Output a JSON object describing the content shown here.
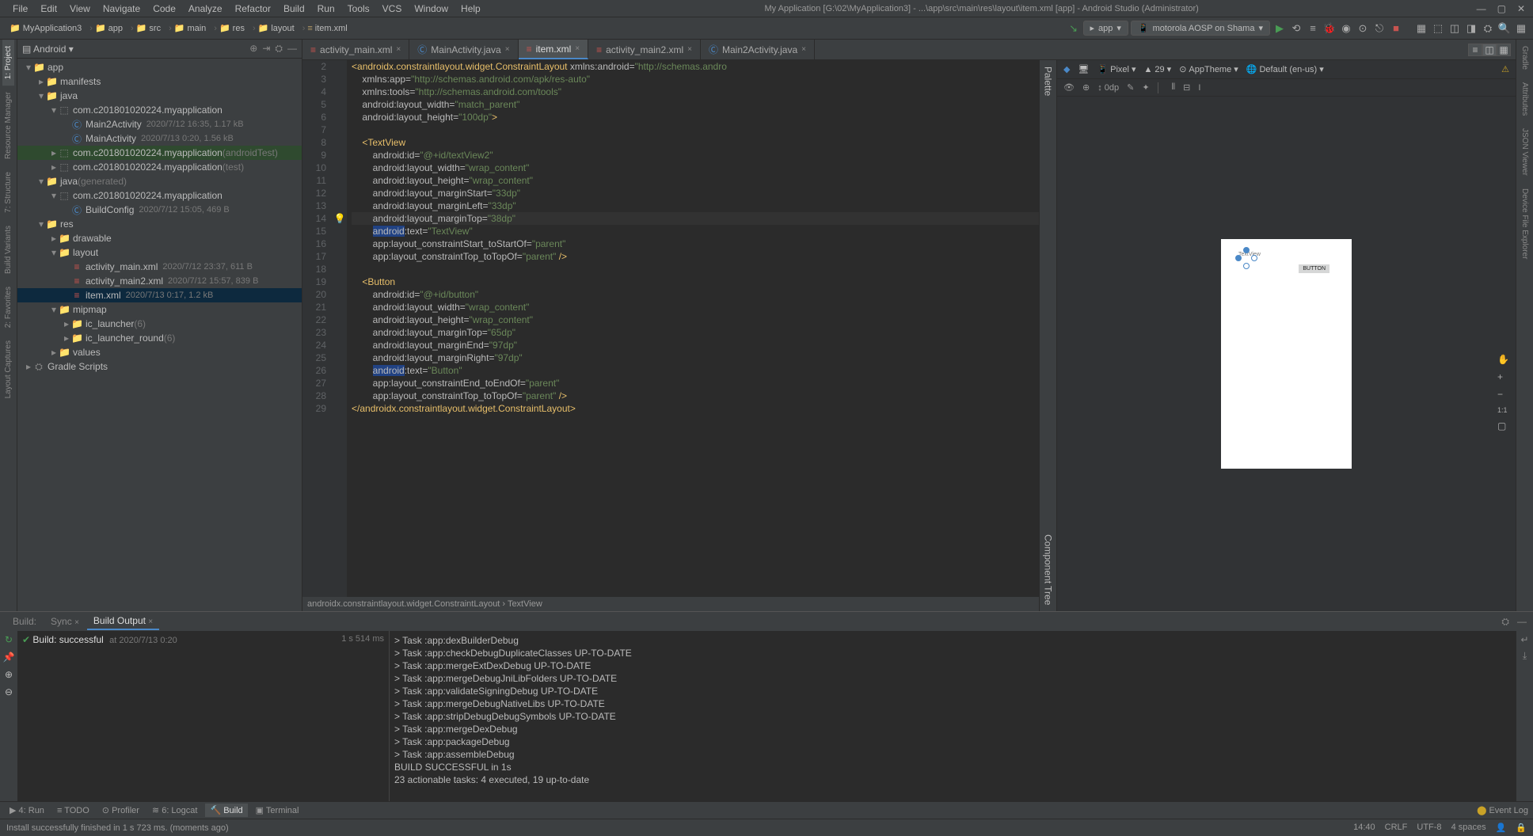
{
  "titlebar": {
    "text": "My Application [G:\\02\\MyApplication3] - ...\\app\\src\\main\\res\\layout\\item.xml [app] - Android Studio (Administrator)"
  },
  "menu": [
    "File",
    "Edit",
    "View",
    "Navigate",
    "Code",
    "Analyze",
    "Refactor",
    "Build",
    "Run",
    "Tools",
    "VCS",
    "Window",
    "Help"
  ],
  "breadcrumbs": [
    "MyApplication3",
    "app",
    "src",
    "main",
    "res",
    "layout",
    "item.xml"
  ],
  "run_config": "app",
  "device": "motorola AOSP on Shama",
  "project_header": "Android",
  "tree": [
    {
      "depth": 0,
      "arrow": "▾",
      "icon": "📁",
      "label": "app",
      "sel": false,
      "cls": "icon-folder"
    },
    {
      "depth": 1,
      "arrow": "▸",
      "icon": "📁",
      "label": "manifests",
      "sel": false,
      "cls": "icon-folder"
    },
    {
      "depth": 1,
      "arrow": "▾",
      "icon": "📁",
      "label": "java",
      "sel": false,
      "cls": "icon-folder"
    },
    {
      "depth": 2,
      "arrow": "▾",
      "icon": "⬚",
      "label": "com.c201801020224.myapplication",
      "sel": false,
      "cls": "icon-pkg"
    },
    {
      "depth": 3,
      "arrow": "",
      "icon": "Ⓒ",
      "label": "Main2Activity",
      "meta": "2020/7/12 16:35, 1.17 kB",
      "sel": false,
      "cls": "icon-class"
    },
    {
      "depth": 3,
      "arrow": "",
      "icon": "Ⓒ",
      "label": "MainActivity",
      "meta": "2020/7/13 0:20, 1.56 kB",
      "sel": false,
      "cls": "icon-class"
    },
    {
      "depth": 2,
      "arrow": "▸",
      "icon": "⬚",
      "label": "com.c201801020224.myapplication",
      "suffix": "(androidTest)",
      "sel": false,
      "hl": true,
      "cls": "icon-pkg"
    },
    {
      "depth": 2,
      "arrow": "▸",
      "icon": "⬚",
      "label": "com.c201801020224.myapplication",
      "suffix": "(test)",
      "sel": false,
      "cls": "icon-pkg"
    },
    {
      "depth": 1,
      "arrow": "▾",
      "icon": "📁",
      "label": "java",
      "suffix": "(generated)",
      "sel": false,
      "cls": "icon-folder"
    },
    {
      "depth": 2,
      "arrow": "▾",
      "icon": "⬚",
      "label": "com.c201801020224.myapplication",
      "sel": false,
      "cls": "icon-pkg"
    },
    {
      "depth": 3,
      "arrow": "",
      "icon": "Ⓒ",
      "label": "BuildConfig",
      "meta": "2020/7/12 15:05, 469 B",
      "sel": false,
      "cls": "icon-class"
    },
    {
      "depth": 1,
      "arrow": "▾",
      "icon": "📁",
      "label": "res",
      "sel": false,
      "cls": "icon-folder"
    },
    {
      "depth": 2,
      "arrow": "▸",
      "icon": "📁",
      "label": "drawable",
      "sel": false,
      "cls": "icon-folder"
    },
    {
      "depth": 2,
      "arrow": "▾",
      "icon": "📁",
      "label": "layout",
      "sel": false,
      "cls": "icon-folder"
    },
    {
      "depth": 3,
      "arrow": "",
      "icon": "≡",
      "label": "activity_main.xml",
      "meta": "2020/7/12 23:37, 611 B",
      "sel": false,
      "cls": "icon-xml"
    },
    {
      "depth": 3,
      "arrow": "",
      "icon": "≡",
      "label": "activity_main2.xml",
      "meta": "2020/7/12 15:57, 839 B",
      "sel": false,
      "cls": "icon-xml"
    },
    {
      "depth": 3,
      "arrow": "",
      "icon": "≡",
      "label": "item.xml",
      "meta": "2020/7/13 0:17, 1.2 kB",
      "sel": true,
      "cls": "icon-xml"
    },
    {
      "depth": 2,
      "arrow": "▾",
      "icon": "📁",
      "label": "mipmap",
      "sel": false,
      "cls": "icon-folder"
    },
    {
      "depth": 3,
      "arrow": "▸",
      "icon": "📁",
      "label": "ic_launcher",
      "suffix": "(6)",
      "sel": false,
      "cls": "icon-folder"
    },
    {
      "depth": 3,
      "arrow": "▸",
      "icon": "📁",
      "label": "ic_launcher_round",
      "suffix": "(6)",
      "sel": false,
      "cls": "icon-folder"
    },
    {
      "depth": 2,
      "arrow": "▸",
      "icon": "📁",
      "label": "values",
      "sel": false,
      "cls": "icon-folder"
    },
    {
      "depth": 0,
      "arrow": "▸",
      "icon": "⛭",
      "label": "Gradle Scripts",
      "sel": false,
      "cls": "icon-pkg"
    }
  ],
  "editor_tabs": [
    {
      "label": "activity_main.xml",
      "icon": "≡",
      "active": false
    },
    {
      "label": "MainActivity.java",
      "icon": "Ⓒ",
      "active": false
    },
    {
      "label": "item.xml",
      "icon": "≡",
      "active": true
    },
    {
      "label": "activity_main2.xml",
      "icon": "≡",
      "active": false
    },
    {
      "label": "Main2Activity.java",
      "icon": "Ⓒ",
      "active": false
    }
  ],
  "code": [
    {
      "n": 2,
      "tokens": [
        {
          "t": "<",
          "c": "t-tag"
        },
        {
          "t": "androidx.constraintlayout.widget.ConstraintLayout",
          "c": "t-tag"
        },
        {
          "t": " xmlns:",
          "c": "t-ns"
        },
        {
          "t": "android",
          "c": "t-attr"
        },
        {
          "t": "=",
          "c": "t-eq"
        },
        {
          "t": "\"http://schemas.andro",
          "c": "t-val"
        }
      ]
    },
    {
      "n": 3,
      "tokens": [
        {
          "t": "    xmlns:",
          "c": "t-ns"
        },
        {
          "t": "app",
          "c": "t-attr"
        },
        {
          "t": "=",
          "c": "t-eq"
        },
        {
          "t": "\"http://schemas.android.com/apk/res-auto\"",
          "c": "t-val"
        }
      ]
    },
    {
      "n": 4,
      "tokens": [
        {
          "t": "    xmlns:",
          "c": "t-ns"
        },
        {
          "t": "tools",
          "c": "t-attr"
        },
        {
          "t": "=",
          "c": "t-eq"
        },
        {
          "t": "\"http://schemas.android.com/tools\"",
          "c": "t-val"
        }
      ]
    },
    {
      "n": 5,
      "tokens": [
        {
          "t": "    android:",
          "c": "t-ns"
        },
        {
          "t": "layout_width",
          "c": "t-attr"
        },
        {
          "t": "=",
          "c": "t-eq"
        },
        {
          "t": "\"match_parent\"",
          "c": "t-val"
        }
      ]
    },
    {
      "n": 6,
      "tokens": [
        {
          "t": "    android:",
          "c": "t-ns"
        },
        {
          "t": "layout_height",
          "c": "t-attr"
        },
        {
          "t": "=",
          "c": "t-eq"
        },
        {
          "t": "\"100dp\"",
          "c": "t-val"
        },
        {
          "t": ">",
          "c": "t-tag"
        }
      ]
    },
    {
      "n": 7,
      "tokens": []
    },
    {
      "n": 8,
      "tokens": [
        {
          "t": "    <",
          "c": "t-tag"
        },
        {
          "t": "TextView",
          "c": "t-tag"
        }
      ]
    },
    {
      "n": 9,
      "tokens": [
        {
          "t": "        android:",
          "c": "t-ns"
        },
        {
          "t": "id",
          "c": "t-attr"
        },
        {
          "t": "=",
          "c": "t-eq"
        },
        {
          "t": "\"@+id/textView2\"",
          "c": "t-val"
        }
      ]
    },
    {
      "n": 10,
      "tokens": [
        {
          "t": "        android:",
          "c": "t-ns"
        },
        {
          "t": "layout_width",
          "c": "t-attr"
        },
        {
          "t": "=",
          "c": "t-eq"
        },
        {
          "t": "\"wrap_content\"",
          "c": "t-val"
        }
      ]
    },
    {
      "n": 11,
      "tokens": [
        {
          "t": "        android:",
          "c": "t-ns"
        },
        {
          "t": "layout_height",
          "c": "t-attr"
        },
        {
          "t": "=",
          "c": "t-eq"
        },
        {
          "t": "\"wrap_content\"",
          "c": "t-val"
        }
      ]
    },
    {
      "n": 12,
      "tokens": [
        {
          "t": "        android:",
          "c": "t-ns"
        },
        {
          "t": "layout_marginStart",
          "c": "t-attr"
        },
        {
          "t": "=",
          "c": "t-eq"
        },
        {
          "t": "\"33dp\"",
          "c": "t-val"
        }
      ]
    },
    {
      "n": 13,
      "tokens": [
        {
          "t": "        android:",
          "c": "t-ns"
        },
        {
          "t": "layout_marginLeft",
          "c": "t-attr"
        },
        {
          "t": "=",
          "c": "t-eq"
        },
        {
          "t": "\"33dp\"",
          "c": "t-val"
        }
      ]
    },
    {
      "n": 14,
      "hl": true,
      "bulb": true,
      "tokens": [
        {
          "t": "        android:",
          "c": "t-ns"
        },
        {
          "t": "layout_marginTop",
          "c": "t-attr"
        },
        {
          "t": "=",
          "c": "t-eq"
        },
        {
          "t": "\"38dp\"",
          "c": "t-val"
        }
      ]
    },
    {
      "n": 15,
      "tokens": [
        {
          "t": "        ",
          "c": ""
        },
        {
          "t": "android",
          "c": "t-hl"
        },
        {
          "t": ":",
          "c": "t-ns"
        },
        {
          "t": "text",
          "c": "t-attr"
        },
        {
          "t": "=",
          "c": "t-eq"
        },
        {
          "t": "\"TextView\"",
          "c": "t-val"
        }
      ]
    },
    {
      "n": 16,
      "tokens": [
        {
          "t": "        app:",
          "c": "t-ns"
        },
        {
          "t": "layout_constraintStart_toStartOf",
          "c": "t-attr"
        },
        {
          "t": "=",
          "c": "t-eq"
        },
        {
          "t": "\"parent\"",
          "c": "t-val"
        }
      ]
    },
    {
      "n": 17,
      "tokens": [
        {
          "t": "        app:",
          "c": "t-ns"
        },
        {
          "t": "layout_constraintTop_toTopOf",
          "c": "t-attr"
        },
        {
          "t": "=",
          "c": "t-eq"
        },
        {
          "t": "\"parent\"",
          "c": "t-val"
        },
        {
          "t": " />",
          "c": "t-tag"
        }
      ]
    },
    {
      "n": 18,
      "tokens": []
    },
    {
      "n": 19,
      "tokens": [
        {
          "t": "    <",
          "c": "t-tag"
        },
        {
          "t": "Button",
          "c": "t-tag"
        }
      ]
    },
    {
      "n": 20,
      "tokens": [
        {
          "t": "        android:",
          "c": "t-ns"
        },
        {
          "t": "id",
          "c": "t-attr"
        },
        {
          "t": "=",
          "c": "t-eq"
        },
        {
          "t": "\"@+id/button\"",
          "c": "t-val"
        }
      ]
    },
    {
      "n": 21,
      "tokens": [
        {
          "t": "        android:",
          "c": "t-ns"
        },
        {
          "t": "layout_width",
          "c": "t-attr"
        },
        {
          "t": "=",
          "c": "t-eq"
        },
        {
          "t": "\"wrap_content\"",
          "c": "t-val"
        }
      ]
    },
    {
      "n": 22,
      "tokens": [
        {
          "t": "        android:",
          "c": "t-ns"
        },
        {
          "t": "layout_height",
          "c": "t-attr"
        },
        {
          "t": "=",
          "c": "t-eq"
        },
        {
          "t": "\"wrap_content\"",
          "c": "t-val"
        }
      ]
    },
    {
      "n": 23,
      "tokens": [
        {
          "t": "        android:",
          "c": "t-ns"
        },
        {
          "t": "layout_marginTop",
          "c": "t-attr"
        },
        {
          "t": "=",
          "c": "t-eq"
        },
        {
          "t": "\"65dp\"",
          "c": "t-val"
        }
      ]
    },
    {
      "n": 24,
      "tokens": [
        {
          "t": "        android:",
          "c": "t-ns"
        },
        {
          "t": "layout_marginEnd",
          "c": "t-attr"
        },
        {
          "t": "=",
          "c": "t-eq"
        },
        {
          "t": "\"97dp\"",
          "c": "t-val"
        }
      ]
    },
    {
      "n": 25,
      "tokens": [
        {
          "t": "        android:",
          "c": "t-ns"
        },
        {
          "t": "layout_marginRight",
          "c": "t-attr"
        },
        {
          "t": "=",
          "c": "t-eq"
        },
        {
          "t": "\"97dp\"",
          "c": "t-val"
        }
      ]
    },
    {
      "n": 26,
      "tokens": [
        {
          "t": "        ",
          "c": ""
        },
        {
          "t": "android",
          "c": "t-hl"
        },
        {
          "t": ":",
          "c": "t-ns"
        },
        {
          "t": "text",
          "c": "t-attr"
        },
        {
          "t": "=",
          "c": "t-eq"
        },
        {
          "t": "\"Button\"",
          "c": "t-val"
        }
      ]
    },
    {
      "n": 27,
      "tokens": [
        {
          "t": "        app:",
          "c": "t-ns"
        },
        {
          "t": "layout_constraintEnd_toEndOf",
          "c": "t-attr"
        },
        {
          "t": "=",
          "c": "t-eq"
        },
        {
          "t": "\"parent\"",
          "c": "t-val"
        }
      ]
    },
    {
      "n": 28,
      "tokens": [
        {
          "t": "        app:",
          "c": "t-ns"
        },
        {
          "t": "layout_constraintTop_toTopOf",
          "c": "t-attr"
        },
        {
          "t": "=",
          "c": "t-eq"
        },
        {
          "t": "\"parent\"",
          "c": "t-val"
        },
        {
          "t": " />",
          "c": "t-tag"
        }
      ]
    },
    {
      "n": 29,
      "tokens": [
        {
          "t": "</",
          "c": "t-tag"
        },
        {
          "t": "androidx.constraintlayout.widget.ConstraintLayout",
          "c": "t-tag"
        },
        {
          "t": ">",
          "c": "t-tag"
        }
      ]
    }
  ],
  "editor_breadcrumb": "androidx.constraintlayout.widget.ConstraintLayout  ›  TextView",
  "design": {
    "device": "Pixel",
    "api": "29",
    "theme": "AppTheme",
    "locale": "Default (en-us)",
    "margin": "0dp",
    "preview_button": "BUTTON",
    "preview_text": "TextView",
    "zoom": "1:1"
  },
  "build": {
    "tabs": [
      "Build:",
      "Sync",
      "Build Output"
    ],
    "status": "Build: successful",
    "status_time": "at 2020/7/13 0:20",
    "duration": "1 s 514 ms",
    "output": [
      "> Task :app:dexBuilderDebug",
      "> Task :app:checkDebugDuplicateClasses UP-TO-DATE",
      "> Task :app:mergeExtDexDebug UP-TO-DATE",
      "> Task :app:mergeDebugJniLibFolders UP-TO-DATE",
      "> Task :app:validateSigningDebug UP-TO-DATE",
      "> Task :app:mergeDebugNativeLibs UP-TO-DATE",
      "> Task :app:stripDebugDebugSymbols UP-TO-DATE",
      "> Task :app:mergeDexDebug",
      "> Task :app:packageDebug",
      "> Task :app:assembleDebug",
      "",
      "BUILD SUCCESSFUL in 1s",
      "23 actionable tasks: 4 executed, 19 up-to-date"
    ]
  },
  "bottom_tools": [
    {
      "label": "▶ 4: Run",
      "active": false
    },
    {
      "label": "≡ TODO",
      "active": false
    },
    {
      "label": "⊙ Profiler",
      "active": false
    },
    {
      "label": "≋ 6: Logcat",
      "active": false
    },
    {
      "label": "🔨 Build",
      "active": true
    },
    {
      "label": "▣ Terminal",
      "active": false
    }
  ],
  "event_log": "Event Log",
  "status": {
    "message": "Install successfully finished in 1 s 723 ms. (moments ago)",
    "pos": "14:40",
    "sep": "CRLF",
    "enc": "UTF-8",
    "indent": "4 spaces"
  },
  "left_tabs": [
    "1: Project",
    "Resource Manager",
    "7: Structure",
    "Build Variants",
    "2: Favorites",
    "Layout Captures"
  ],
  "right_tabs": [
    "Gradle",
    "Attributes",
    "JSON Viewer",
    "Device File Explorer"
  ],
  "design_side_tabs": [
    "Palette",
    "Component Tree"
  ]
}
